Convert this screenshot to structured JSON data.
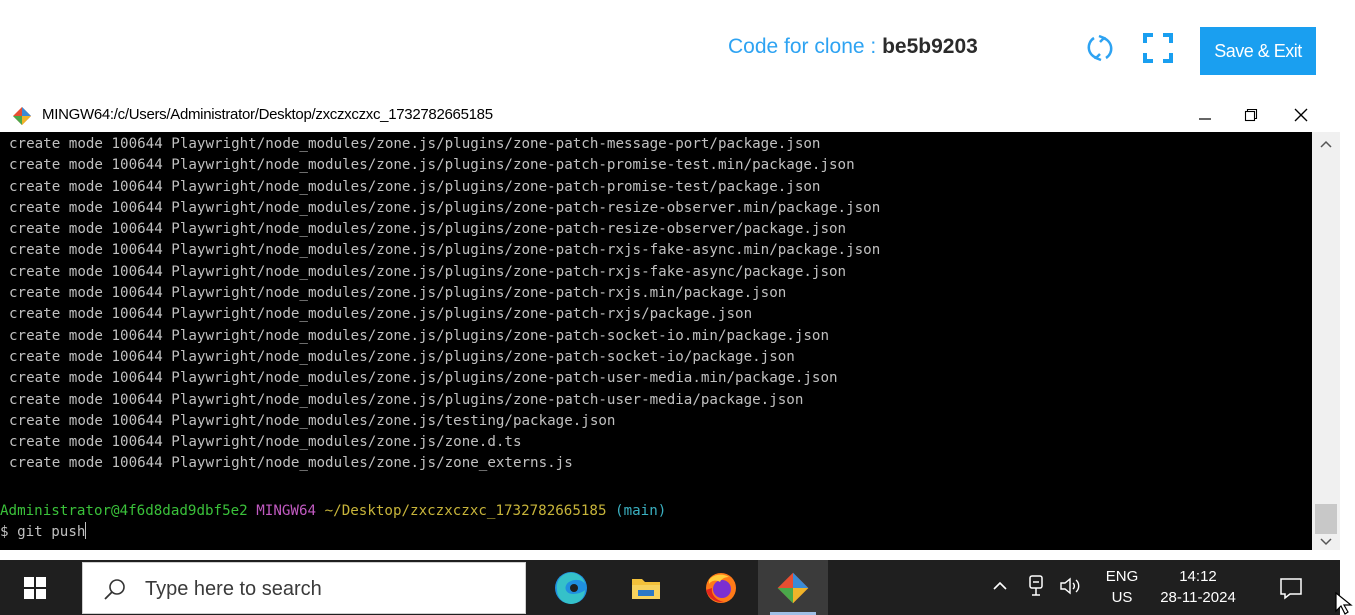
{
  "header": {
    "clone_label": "Code for clone :",
    "clone_code": "be5b9203",
    "save_exit_label": "Save & Exit",
    "icons": [
      "sync-icon",
      "fullscreen-icon"
    ]
  },
  "window": {
    "title": "MINGW64:/c/Users/Administrator/Desktop/zxczxczxc_1732782665185",
    "icon": "git-bash-icon",
    "controls": [
      "minimize-icon",
      "maximize-icon",
      "close-icon"
    ]
  },
  "terminal": {
    "lines": [
      "create mode 100644 Playwright/node_modules/zone.js/plugins/zone-patch-message-port/package.json",
      "create mode 100644 Playwright/node_modules/zone.js/plugins/zone-patch-promise-test.min/package.json",
      "create mode 100644 Playwright/node_modules/zone.js/plugins/zone-patch-promise-test/package.json",
      "create mode 100644 Playwright/node_modules/zone.js/plugins/zone-patch-resize-observer.min/package.json",
      "create mode 100644 Playwright/node_modules/zone.js/plugins/zone-patch-resize-observer/package.json",
      "create mode 100644 Playwright/node_modules/zone.js/plugins/zone-patch-rxjs-fake-async.min/package.json",
      "create mode 100644 Playwright/node_modules/zone.js/plugins/zone-patch-rxjs-fake-async/package.json",
      "create mode 100644 Playwright/node_modules/zone.js/plugins/zone-patch-rxjs.min/package.json",
      "create mode 100644 Playwright/node_modules/zone.js/plugins/zone-patch-rxjs/package.json",
      "create mode 100644 Playwright/node_modules/zone.js/plugins/zone-patch-socket-io.min/package.json",
      "create mode 100644 Playwright/node_modules/zone.js/plugins/zone-patch-socket-io/package.json",
      "create mode 100644 Playwright/node_modules/zone.js/plugins/zone-patch-user-media.min/package.json",
      "create mode 100644 Playwright/node_modules/zone.js/plugins/zone-patch-user-media/package.json",
      "create mode 100644 Playwright/node_modules/zone.js/testing/package.json",
      "create mode 100644 Playwright/node_modules/zone.js/zone.d.ts",
      "create mode 100644 Playwright/node_modules/zone.js/zone_externs.js"
    ],
    "prompt": {
      "user_host": "Administrator@4f6d8dad9dbf5e2",
      "system": "MINGW64",
      "path": "~/Desktop/zxczxczxc_1732782665185",
      "branch": "(main)"
    },
    "command": "$ git push"
  },
  "taskbar": {
    "search_placeholder": "Type here to search",
    "apps": [
      "edge-icon",
      "file-explorer-icon",
      "firefox-icon",
      "git-bash-icon"
    ],
    "language_top": "ENG",
    "language_bottom": "US",
    "time": "14:12",
    "date": "28-11-2024"
  },
  "colors": {
    "accent": "#1a9ff0",
    "clone_text": "#2ea3f2",
    "terminal_bg": "#000000",
    "terminal_text": "#c0c0c0",
    "prompt_user": "#3ac13a",
    "prompt_system": "#c15ac1",
    "prompt_path": "#c7b43a",
    "prompt_branch": "#3ab0c1",
    "taskbar_bg": "#1f1f1f"
  }
}
